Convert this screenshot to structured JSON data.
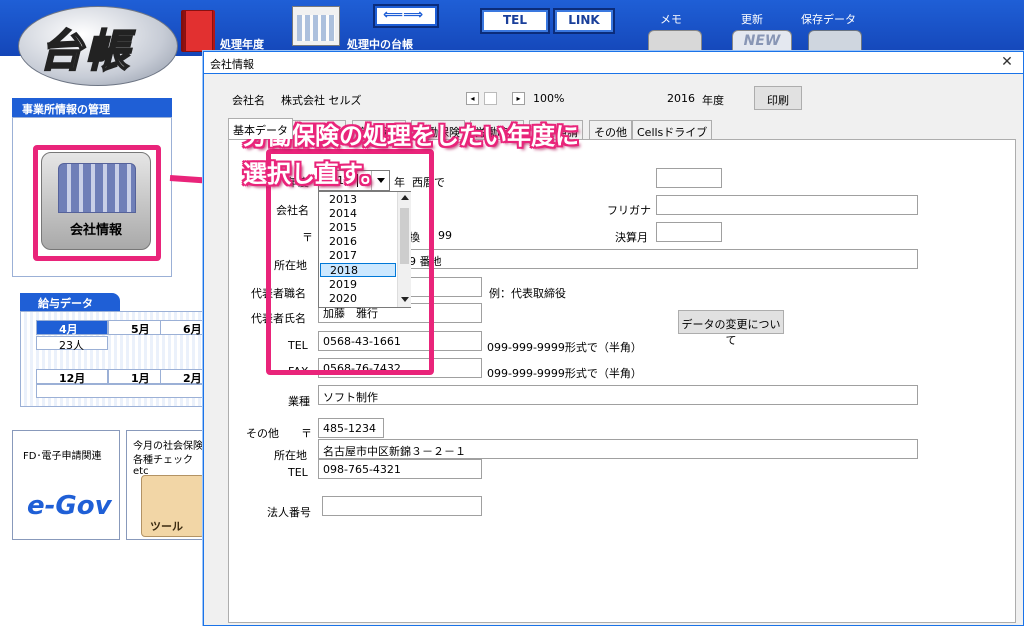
{
  "app": {
    "logo_text": "台帳",
    "fiscal_year_label": "処理年度",
    "current_ledger_label": "処理中の台帳",
    "arrows_glyph": "⟸⟹",
    "tel_label": "TEL",
    "link_label": "LINK",
    "memo_label": "メモ",
    "update_label": "更新",
    "new_label": "NEW",
    "save_data_label": "保存データ"
  },
  "sidebar": {
    "office_panel_title": "事業所情報の管理",
    "company_info_label": "会社情報",
    "salary_title": "給与データ",
    "months_row1": [
      "4月",
      "5月",
      "6月"
    ],
    "months_row2": [
      "12月",
      "1月",
      "2月"
    ],
    "salary_count": "23人",
    "egov_label": "FD･電子申請関連",
    "egov_logo": "e-Gov",
    "tools_label1": "今月の社会保険",
    "tools_label2": "各種チェック etc",
    "tools_icon_text": "ツール"
  },
  "dialog": {
    "title": "会社情報",
    "close_glyph": "✕",
    "company_name_label": "会社名",
    "company_name_value": "株式会社 セルズ",
    "zoom_value": "100%",
    "year_display": "2016",
    "year_unit_label": "年度",
    "print_label": "印刷",
    "tabs": [
      "基本データ",
      "社会保険",
      "雇用保険",
      "労働保険",
      "労働時間",
      "電子申請",
      "その他",
      "Cellsドライブ"
    ],
    "form": {
      "year_label": "年度",
      "year_value": "2016",
      "year_suffix": "年",
      "western_label": "西暦で",
      "year_options": [
        "2013",
        "2014",
        "2015",
        "2016",
        "2017",
        "2018",
        "2019",
        "2020"
      ],
      "year_selected": "2018",
      "company_label": "会社名",
      "furigana_label": "フリガナ",
      "postal_label": "〒",
      "phone_label_partial": "換",
      "phone_partial": "99",
      "closing_month_label": "決算月",
      "address_label": "所在地",
      "address_partial": "9 番地",
      "rep_title_label": "代表者職名",
      "rep_title_example": "例：代表取締役",
      "rep_name_label": "代表者氏名",
      "rep_name_partial": "加藤　雅行",
      "data_change_button": "データの変更について",
      "tel_label": "TEL",
      "tel_value": "0568-43-1661",
      "tel_hint": "099-999-9999形式で（半角）",
      "fax_label": "FAX",
      "fax_value": "0568-76-7432",
      "fax_hint": "099-999-9999形式で（半角）",
      "industry_label": "業種",
      "industry_value": "ソフト制作",
      "other_label": "その他",
      "other_postal_label": "〒",
      "other_postal_value": "485-1234",
      "other_address_label": "所在地",
      "other_address_value": "名古屋市中区新錦３－２－１",
      "other_tel_label": "TEL",
      "other_tel_value": "098-765-4321",
      "corp_number_label": "法人番号",
      "corp_number_value": ""
    }
  },
  "annotation": {
    "line1": "労働保険の処理をしたい年度に",
    "line2": "選択し直す。",
    "color": "#e9247a"
  }
}
